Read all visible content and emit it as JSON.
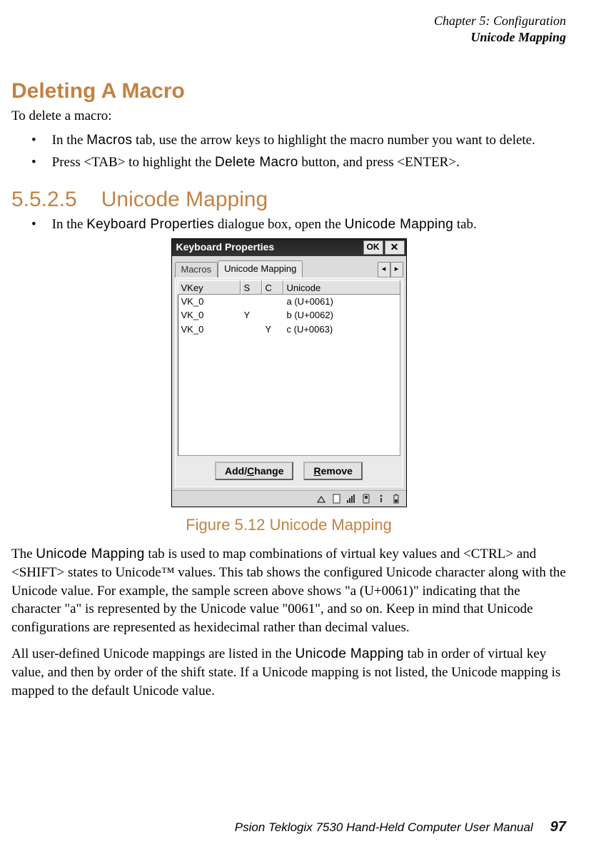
{
  "header": {
    "line1": "Chapter 5: Configuration",
    "line2": "Unicode Mapping"
  },
  "section1": {
    "title": "Deleting A Macro",
    "lead": "To delete a macro:",
    "b1a": "In the ",
    "b1b": "Macros",
    "b1c": " tab, use the arrow keys to highlight the macro number you want to delete.",
    "b2a": "Press <TAB> to highlight the ",
    "b2b": "Delete Macro",
    "b2c": " button, and press <ENTER>."
  },
  "section2": {
    "number": "5.5.2.5",
    "title": "Unicode Mapping",
    "b1a": "In the ",
    "b1b": "Keyboard Properties",
    "b1c": " dialogue box, open the ",
    "b1d": "Unicode Mapping",
    "b1e": " tab."
  },
  "device": {
    "title": "Keyboard Properties",
    "ok": "OK",
    "tabs": {
      "macros": "Macros",
      "unicode": "Unicode Mapping"
    },
    "cols": {
      "vkey": "VKey",
      "s": "S",
      "c": "C",
      "unicode": "Unicode"
    },
    "rows": [
      {
        "vkey": "VK_0",
        "s": "",
        "c": "",
        "unicode": "a (U+0061)"
      },
      {
        "vkey": "VK_0",
        "s": "Y",
        "c": "",
        "unicode": "b (U+0062)"
      },
      {
        "vkey": "VK_0",
        "s": "",
        "c": "Y",
        "unicode": "c (U+0063)"
      }
    ],
    "btn_add_pre": "Add/",
    "btn_add_ul": "C",
    "btn_add_post": "hange",
    "btn_rem_ul": "R",
    "btn_rem_post": "emove"
  },
  "figure": {
    "caption": "Figure 5.12 Unicode Mapping"
  },
  "body": {
    "p1a": "The ",
    "p1b": "Unicode Mapping",
    "p1c": " tab is used to map combinations of virtual key values and <CTRL> and <SHIFT> states to Unicode™ values. This tab shows the configured Unicode character along with the Unicode value. For example, the sample screen above shows \"a (U+0061)\" indicating that the character \"a\" is represented by the Unicode value \"0061\", and so on. Keep in mind that Unicode configurations are represented as hexidecimal rather than decimal values.",
    "p2a": "All user-defined Unicode mappings are listed in the ",
    "p2b": "Unicode Mapping",
    "p2c": " tab in order of virtual key value, and then by order of the shift state. If a Unicode mapping is not listed, the Unicode mapping is mapped to the default Unicode value."
  },
  "footer": {
    "book": "Psion Teklogix 7530 Hand-Held Computer User Manual",
    "page": "97"
  }
}
